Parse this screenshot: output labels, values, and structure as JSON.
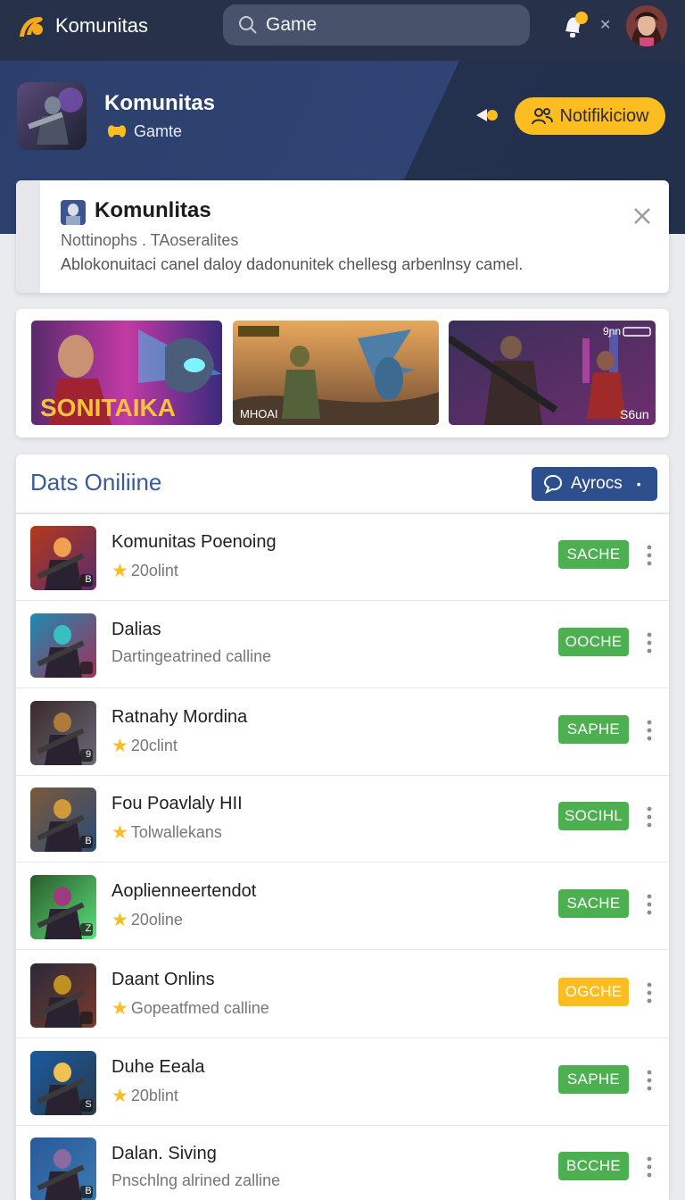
{
  "topbar": {
    "brand": "Komunitas",
    "search_value": "Game"
  },
  "hero": {
    "title": "Komunitas",
    "subtitle": "Gamte",
    "notify_label": "Notifikiciow"
  },
  "info": {
    "title": "Komunlitas",
    "subtitle": "Nottinophs . TAoseralites",
    "body": "Ablokonuitaci canel daloy dadonunitek chellesg arbenlnsy camel."
  },
  "banners": [
    {
      "label": "SONITAIKA"
    },
    {
      "label": "MHOAI"
    },
    {
      "label": "S6un",
      "top_label": "9ɲn"
    }
  ],
  "list": {
    "title": "Dats Oniliine",
    "sort_label": "Ayrocs",
    "rows": [
      {
        "name": "Komunitas Poenoing",
        "meta": "20olint",
        "star": true,
        "status": "SACHE",
        "color": "#4caf50",
        "badge": "B"
      },
      {
        "name": "Dalias",
        "meta": "Dartingeatrined calline",
        "star": false,
        "status": "OOCHE",
        "color": "#4caf50",
        "badge": ""
      },
      {
        "name": "Ratnahy Mordina",
        "meta": "20clint",
        "star": true,
        "status": "SAPHE",
        "color": "#4caf50",
        "badge": "9"
      },
      {
        "name": "Fou Poavlaly HII",
        "meta": "Tolwallekans",
        "star": true,
        "status": "SOCIHL",
        "color": "#4caf50",
        "badge": "B"
      },
      {
        "name": "Aoplienneertendot",
        "meta": "20oline",
        "star": true,
        "status": "SACHE",
        "color": "#4caf50",
        "badge": "Z"
      },
      {
        "name": "Daant Onlins",
        "meta": "Gopeatfmed calline",
        "star": true,
        "status": "OGCHE",
        "color": "#fbbd20",
        "badge": ""
      },
      {
        "name": "Duhe Eeala",
        "meta": "20blint",
        "star": true,
        "status": "SAPHE",
        "color": "#4caf50",
        "badge": "S"
      },
      {
        "name": "Dalan. Siving",
        "meta": "Pnschlng alrined zalline",
        "star": false,
        "status": "BCCHE",
        "color": "#4caf50",
        "badge": "B"
      }
    ]
  }
}
